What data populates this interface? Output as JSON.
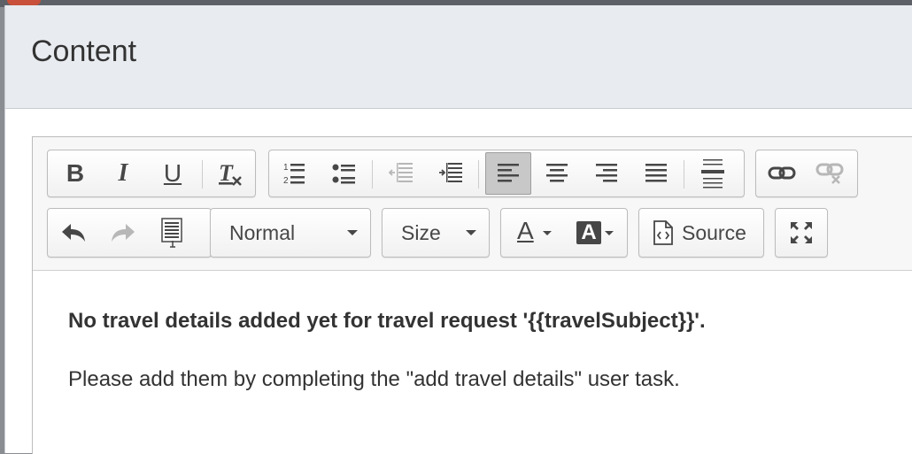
{
  "dialog": {
    "title": "Content"
  },
  "toolbar": {
    "row1": {
      "basic": [
        {
          "name": "bold-button",
          "icon": "bold-icon",
          "glyph": "B"
        },
        {
          "name": "italic-button",
          "icon": "italic-icon",
          "glyph": "I"
        },
        {
          "name": "underline-button",
          "icon": "underline-icon",
          "glyph": "U"
        },
        {
          "name": "remove-format-button",
          "icon": "remove-format-icon",
          "glyph": "Tx"
        }
      ],
      "paragraph": [
        {
          "name": "numbered-list-button",
          "icon": "numbered-list-icon"
        },
        {
          "name": "bulleted-list-button",
          "icon": "bulleted-list-icon"
        },
        {
          "name": "decrease-indent-button",
          "icon": "outdent-icon",
          "disabled": true
        },
        {
          "name": "increase-indent-button",
          "icon": "indent-icon"
        },
        {
          "name": "align-left-button",
          "icon": "align-left-icon",
          "active": true
        },
        {
          "name": "align-center-button",
          "icon": "align-center-icon"
        },
        {
          "name": "align-right-button",
          "icon": "align-right-icon"
        },
        {
          "name": "justify-button",
          "icon": "justify-icon"
        },
        {
          "name": "horizontal-rule-button",
          "icon": "horizontal-rule-icon"
        }
      ],
      "links": [
        {
          "name": "link-button",
          "icon": "link-icon"
        },
        {
          "name": "unlink-button",
          "icon": "unlink-icon",
          "disabled": true
        }
      ]
    },
    "row2": {
      "history": [
        {
          "name": "undo-button",
          "icon": "undo-icon"
        },
        {
          "name": "redo-button",
          "icon": "redo-icon",
          "disabled": true
        },
        {
          "name": "paste-from-word-button",
          "icon": "paste-icon"
        }
      ],
      "format_label": "Normal",
      "size_label": "Size",
      "text_color_glyph": "A",
      "bg_color_glyph": "A",
      "source_label": "Source",
      "maximize_icon": "maximize-icon"
    }
  },
  "body": {
    "heading": "No travel details added yet for travel request '{{travelSubject}}'.",
    "paragraph": "Please add them by completing the \"add travel details\" user task."
  },
  "colors": {
    "active_bg": "#c8c8c8",
    "icon": "#474747",
    "disabled_icon": "#b7b7b7"
  }
}
